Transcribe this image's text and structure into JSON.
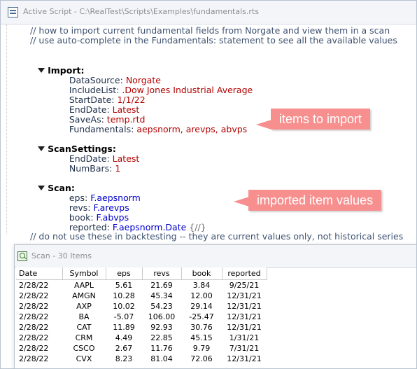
{
  "editor": {
    "title": "Active Script - C:\\RealTest\\Scripts\\Examples\\fundamentals.rts",
    "comments_top": [
      "// how to import current fundamental fields from Norgate and view them in a scan",
      "// use auto-complete in the Fundamentals: statement to see all the available values"
    ],
    "import": {
      "header": "Import:",
      "datasource_key": "DataSource:",
      "datasource_val": "Norgate",
      "includelist_key": "IncludeList:",
      "includelist_val": ".Dow Jones Industrial Average",
      "startdate_key": "StartDate:",
      "startdate_val": "1/1/22",
      "enddate_key": "EndDate:",
      "enddate_val": "Latest",
      "saveas_key": "SaveAs:",
      "saveas_val": "temp.rtd",
      "fundamentals_key": "Fundamentals:",
      "fundamentals_val": "aepsnorm, arevps, abvps"
    },
    "scansettings": {
      "header": "ScanSettings:",
      "enddate_key": "EndDate:",
      "enddate_val": "Latest",
      "numbars_key": "NumBars:",
      "numbars_val": "1"
    },
    "scan": {
      "header": "Scan:",
      "eps_key": "eps:",
      "eps_val": "F.aepsnorm",
      "revs_key": "revs:",
      "revs_val": "F.arevps",
      "book_key": "book:",
      "book_val": "F.abvps",
      "reported_key": "reported:",
      "reported_val": "F.aepsnorm.Date",
      "reported_suffix": "{//}"
    },
    "comment_bottom": "// do not use these in backtesting -- they are current values only, not historical series",
    "callouts": {
      "import_label": "items to import",
      "scan_label": "imported item values"
    }
  },
  "scan_window": {
    "title": "Scan - 30 Items",
    "columns": [
      "Date",
      "Symbol",
      "eps",
      "revs",
      "book",
      "reported"
    ],
    "rows": [
      [
        "2/28/22",
        "AAPL",
        "5.61",
        "21.69",
        "3.84",
        "9/25/21"
      ],
      [
        "2/28/22",
        "AMGN",
        "10.28",
        "45.34",
        "12.00",
        "12/31/21"
      ],
      [
        "2/28/22",
        "AXP",
        "10.02",
        "54.23",
        "29.14",
        "12/31/21"
      ],
      [
        "2/28/22",
        "BA",
        "-5.07",
        "106.00",
        "-25.47",
        "12/31/21"
      ],
      [
        "2/28/22",
        "CAT",
        "11.89",
        "92.93",
        "30.76",
        "12/31/21"
      ],
      [
        "2/28/22",
        "CRM",
        "4.49",
        "22.85",
        "45.15",
        "1/31/21"
      ],
      [
        "2/28/22",
        "CSCO",
        "2.67",
        "11.76",
        "9.79",
        "7/31/21"
      ],
      [
        "2/28/22",
        "CVX",
        "8.23",
        "81.04",
        "72.06",
        "12/31/21"
      ]
    ]
  },
  "colors": {
    "callout": "#f78f8f",
    "value_red": "#b30000",
    "value_blue": "#0000cc"
  }
}
